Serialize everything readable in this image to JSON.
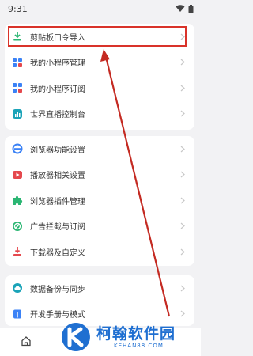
{
  "status_bar": {
    "time": "9:31"
  },
  "menu_group_1": [
    {
      "label": "剪贴板口令导入",
      "icon": "clipboard-import-icon"
    },
    {
      "label": "我的小程序管理",
      "icon": "mini-program-manage-icon"
    },
    {
      "label": "我的小程序订阅",
      "icon": "mini-program-subscribe-icon"
    },
    {
      "label": "世界直播控制台",
      "icon": "live-console-icon"
    }
  ],
  "menu_group_2": [
    {
      "label": "浏览器功能设置",
      "icon": "browser-settings-icon"
    },
    {
      "label": "播放器相关设置",
      "icon": "player-settings-icon"
    },
    {
      "label": "浏览器插件管理",
      "icon": "plugin-puzzle-icon"
    },
    {
      "label": "广告拦截与订阅",
      "icon": "ad-block-icon"
    },
    {
      "label": "下载器及自定义",
      "icon": "downloader-icon"
    }
  ],
  "menu_group_3": [
    {
      "label": "数据备份与同步",
      "icon": "cloud-backup-icon"
    },
    {
      "label": "开发手册与模式",
      "icon": "dev-manual-icon"
    }
  ],
  "watermark": {
    "title": "柯翰软件园",
    "url": "KEHAN88.COM"
  },
  "colors": {
    "accent": "#d9332a",
    "brand_blue": "#1f6fd1",
    "icon_green": "#2bb673",
    "icon_red": "#e5484d",
    "icon_blue": "#3b82f6",
    "background": "#f2f2f4"
  }
}
